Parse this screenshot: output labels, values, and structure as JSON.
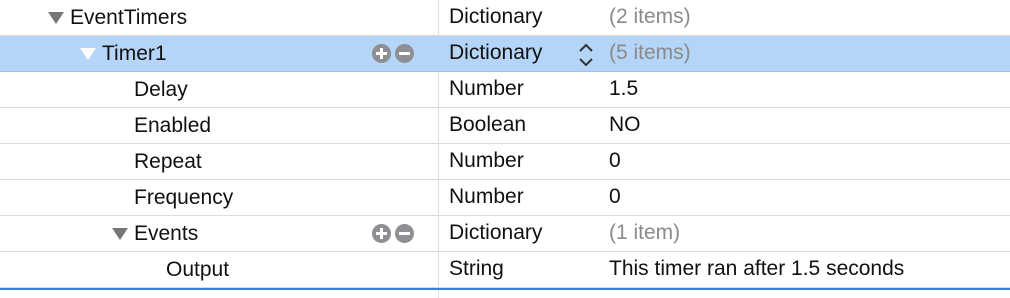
{
  "rows": [
    {
      "key": "EventTimers",
      "type": "Dictionary",
      "value": "(2 items)"
    },
    {
      "key": "Timer1",
      "type": "Dictionary",
      "value": "(5 items)"
    },
    {
      "key": "Delay",
      "type": "Number",
      "value": "1.5"
    },
    {
      "key": "Enabled",
      "type": "Boolean",
      "value": "NO"
    },
    {
      "key": "Repeat",
      "type": "Number",
      "value": "0"
    },
    {
      "key": "Frequency",
      "type": "Number",
      "value": "0"
    },
    {
      "key": "Events",
      "type": "Dictionary",
      "value": "(1 item)"
    },
    {
      "key": "Output",
      "type": "String",
      "value": "This timer ran after 1.5 seconds"
    }
  ],
  "colors": {
    "selection": "#b5d5f8",
    "separator": "#dcdcdc",
    "muted_text": "#8a8a8a",
    "control_gray": "#8e8e93",
    "focus_blue": "#3a7fd8"
  },
  "icons": {
    "disclosure": "disclosure-triangle-icon",
    "add": "plus-circle-icon",
    "remove": "minus-circle-icon",
    "stepper": "up-down-stepper-icon"
  }
}
